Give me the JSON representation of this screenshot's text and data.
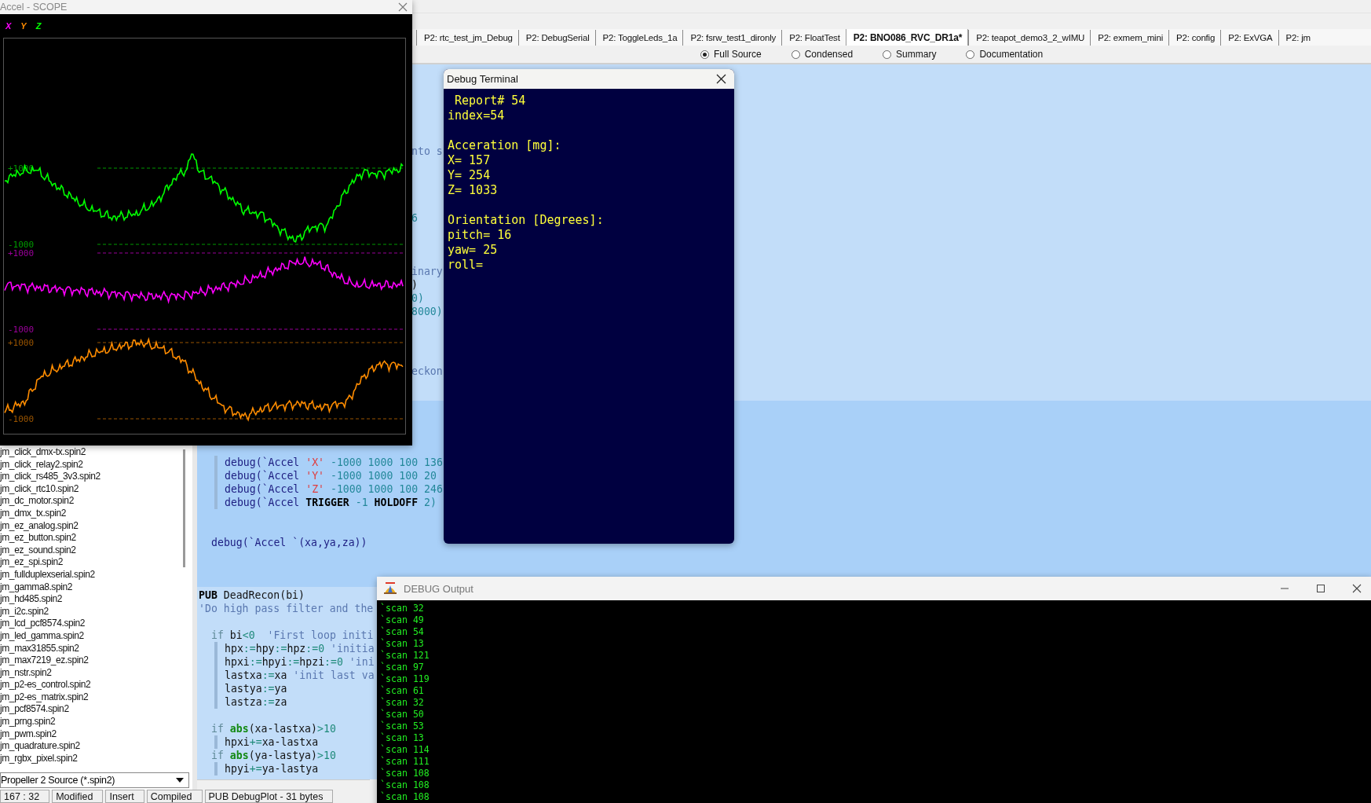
{
  "ide": {
    "tabs": [
      {
        "label": "P2: rtc_test_jm_Debug",
        "selected": false
      },
      {
        "label": "P2: DebugSerial",
        "selected": false
      },
      {
        "label": "P2: ToggleLeds_1a",
        "selected": false
      },
      {
        "label": "P2: fsrw_test1_dironly",
        "selected": false
      },
      {
        "label": "P2: FloatTest",
        "selected": false
      },
      {
        "label": "P2: BNO086_RVC_DR1a*",
        "selected": true
      },
      {
        "label": "P2: teapot_demo3_2_wIMU",
        "selected": false
      },
      {
        "label": "P2: exmem_mini",
        "selected": false
      },
      {
        "label": "P2: config",
        "selected": false
      },
      {
        "label": "P2: ExVGA",
        "selected": false
      },
      {
        "label": "P2: jm",
        "selected": false
      }
    ],
    "view_options": [
      {
        "label": "Full Source",
        "selected": true
      },
      {
        "label": "Condensed",
        "selected": false
      },
      {
        "label": "Summary",
        "selected": false
      },
      {
        "label": "Documentation",
        "selected": false
      }
    ],
    "editor": {
      "fragments": [
        {
          "kind": "comment",
          "text": "nto s"
        },
        {
          "kind": "number",
          "text": "6"
        },
        {
          "kind": "comment",
          "text": "inary"
        },
        {
          "kind": "plain",
          "text": ")"
        },
        {
          "kind": "number",
          "text": "0)"
        },
        {
          "kind": "number",
          "text": "8000)"
        },
        {
          "kind": "comment",
          "text": "eckon"
        }
      ],
      "sections": [
        {
          "kind": "scope_setup",
          "blocks": [
            [
              {
                "kind": "body",
                "parts": [
                  {
                    "kind": "call",
                    "text": "debug(`Accel "
                  },
                  {
                    "kind": "string",
                    "text": "'X'"
                  },
                  {
                    "kind": "number",
                    "text": " -1000 1000 100 136"
                  }
                ]
              },
              {
                "kind": "body",
                "parts": [
                  {
                    "kind": "call",
                    "text": "debug(`Accel "
                  },
                  {
                    "kind": "string",
                    "text": "'Y'"
                  },
                  {
                    "kind": "number",
                    "text": " -1000 1000 100 20"
                  }
                ]
              },
              {
                "kind": "body",
                "parts": [
                  {
                    "kind": "call",
                    "text": "debug(`Accel "
                  },
                  {
                    "kind": "string",
                    "text": "'Z'"
                  },
                  {
                    "kind": "number",
                    "text": " -1000 1000 100 246"
                  }
                ]
              },
              {
                "kind": "body",
                "parts": [
                  {
                    "kind": "call",
                    "text": "debug(`Accel "
                  },
                  {
                    "kind": "keyword",
                    "text": "TRIGGER"
                  },
                  {
                    "kind": "number",
                    "text": " -1 "
                  },
                  {
                    "kind": "keyword",
                    "text": "HOLDOFF"
                  },
                  {
                    "kind": "number",
                    "text": " 2)"
                  }
                ]
              }
            ],
            [
              {
                "kind": "stmt",
                "parts": [
                  {
                    "kind": "call",
                    "text": "debug(`Accel `(xa,ya,za))"
                  }
                ]
              }
            ]
          ]
        },
        {
          "kind": "method",
          "blocks": [
            [
              {
                "kind": "decl",
                "parts": [
                  {
                    "kind": "keyword",
                    "text": "PUB"
                  },
                  {
                    "kind": "plain",
                    "text": " DeadRecon(bi)"
                  }
                ]
              },
              {
                "kind": "decl",
                "parts": [
                  {
                    "kind": "comment",
                    "text": "'Do high pass filter and the"
                  }
                ]
              }
            ],
            [
              {
                "kind": "stmt",
                "parts": [
                  {
                    "kind": "control",
                    "text": "if"
                  },
                  {
                    "kind": "plain",
                    "text": " bi"
                  },
                  {
                    "kind": "operator",
                    "text": "<0"
                  },
                  {
                    "kind": "comment",
                    "text": "  'First loop initi"
                  }
                ]
              },
              {
                "kind": "body",
                "parts": [
                  {
                    "kind": "plain",
                    "text": "hpx"
                  },
                  {
                    "kind": "operator",
                    "text": ":="
                  },
                  {
                    "kind": "plain",
                    "text": "hpy"
                  },
                  {
                    "kind": "operator",
                    "text": ":="
                  },
                  {
                    "kind": "plain",
                    "text": "hpz"
                  },
                  {
                    "kind": "operator",
                    "text": ":=0"
                  },
                  {
                    "kind": "comment",
                    "text": " 'initia"
                  }
                ]
              },
              {
                "kind": "body",
                "parts": [
                  {
                    "kind": "plain",
                    "text": "hpxi"
                  },
                  {
                    "kind": "operator",
                    "text": ":="
                  },
                  {
                    "kind": "plain",
                    "text": "hpyi"
                  },
                  {
                    "kind": "operator",
                    "text": ":="
                  },
                  {
                    "kind": "plain",
                    "text": "hpzi"
                  },
                  {
                    "kind": "operator",
                    "text": ":=0"
                  },
                  {
                    "kind": "comment",
                    "text": " 'ini"
                  }
                ]
              },
              {
                "kind": "body",
                "parts": [
                  {
                    "kind": "plain",
                    "text": "lastxa"
                  },
                  {
                    "kind": "operator",
                    "text": ":="
                  },
                  {
                    "kind": "plain",
                    "text": "xa"
                  },
                  {
                    "kind": "comment",
                    "text": " 'init last va"
                  }
                ]
              },
              {
                "kind": "body",
                "parts": [
                  {
                    "kind": "plain",
                    "text": "lastya"
                  },
                  {
                    "kind": "operator",
                    "text": ":="
                  },
                  {
                    "kind": "plain",
                    "text": "ya"
                  }
                ]
              },
              {
                "kind": "body",
                "parts": [
                  {
                    "kind": "plain",
                    "text": "lastza"
                  },
                  {
                    "kind": "operator",
                    "text": ":="
                  },
                  {
                    "kind": "plain",
                    "text": "za"
                  }
                ]
              }
            ],
            [
              {
                "kind": "stmt",
                "parts": [
                  {
                    "kind": "control",
                    "text": "if "
                  },
                  {
                    "kind": "builtin",
                    "text": "abs"
                  },
                  {
                    "kind": "plain",
                    "text": "(xa-lastxa)"
                  },
                  {
                    "kind": "operator",
                    "text": ">10"
                  }
                ]
              },
              {
                "kind": "body",
                "parts": [
                  {
                    "kind": "plain",
                    "text": "hpxi"
                  },
                  {
                    "kind": "operator",
                    "text": "+="
                  },
                  {
                    "kind": "plain",
                    "text": "xa-lastxa"
                  }
                ]
              },
              {
                "kind": "stmt",
                "parts": [
                  {
                    "kind": "control",
                    "text": "if "
                  },
                  {
                    "kind": "builtin",
                    "text": "abs"
                  },
                  {
                    "kind": "plain",
                    "text": "(ya-lastya)"
                  },
                  {
                    "kind": "operator",
                    "text": ">10"
                  }
                ]
              },
              {
                "kind": "body",
                "parts": [
                  {
                    "kind": "plain",
                    "text": "hpyi"
                  },
                  {
                    "kind": "operator",
                    "text": "+="
                  },
                  {
                    "kind": "plain",
                    "text": "ya-lastya"
                  }
                ]
              }
            ]
          ]
        }
      ]
    },
    "files": [
      "jm_click_dmx-tx.spin2",
      "jm_click_relay2.spin2",
      "jm_click_rs485_3v3.spin2",
      "jm_click_rtc10.spin2",
      "jm_dc_motor.spin2",
      "jm_dmx_tx.spin2",
      "jm_ez_analog.spin2",
      "jm_ez_button.spin2",
      "jm_ez_sound.spin2",
      "jm_ez_spi.spin2",
      "jm_fullduplexserial.spin2",
      "jm_gamma8.spin2",
      "jm_hd485.spin2",
      "jm_i2c.spin2",
      "jm_lcd_pcf8574.spin2",
      "jm_led_gamma.spin2",
      "jm_max31855.spin2",
      "jm_max7219_ez.spin2",
      "jm_nstr.spin2",
      "jm_p2-es_control.spin2",
      "jm_p2-es_matrix.spin2",
      "jm_pcf8574.spin2",
      "jm_prng.spin2",
      "jm_pwm.spin2",
      "jm_quadrature.spin2",
      "jm_rgbx_pixel.spin2"
    ],
    "file_filter": "Propeller 2 Source (*.spin2)",
    "status_bar": [
      "167 : 32",
      "Modified",
      "Insert",
      "Compiled",
      "PUB DebugPlot  -  31 bytes"
    ]
  },
  "scope_window": {
    "title": "Accel - SCOPE",
    "legend": [
      {
        "label": "X",
        "color": "#ff00ff"
      },
      {
        "label": "Y",
        "color": "#ff8c00"
      },
      {
        "label": "Z",
        "color": "#00ff00"
      }
    ],
    "bands": [
      {
        "high": "+1000",
        "low": "-1000",
        "color": "#00ff00"
      },
      {
        "high": "+1000",
        "low": "-1000",
        "color": "#ff00ff"
      },
      {
        "high": "+1000",
        "low": "-1000",
        "color": "#ff8c00"
      }
    ]
  },
  "terminal_window": {
    "title": "Debug Terminal",
    "paragraphs": [
      [
        " Report# 54",
        "index=54"
      ],
      [
        "Acceration [mg]:",
        "X= 157",
        "Y= 254",
        "Z= 1033"
      ],
      [
        "Orientation [Degrees]:",
        "pitch= 16",
        "yaw= 25",
        "roll="
      ]
    ]
  },
  "output_window": {
    "title": "DEBUG Output",
    "lines": [
      "`scan 32",
      "`scan 49",
      "`scan 54",
      "`scan 13",
      "`scan 121",
      "`scan 97",
      "`scan 119",
      "`scan 61",
      "`scan 32",
      "`scan 50",
      "`scan 53",
      "`scan 13",
      "`scan 114",
      "`scan 111",
      "`scan 108",
      "`scan 108",
      "`scan 108"
    ]
  }
}
